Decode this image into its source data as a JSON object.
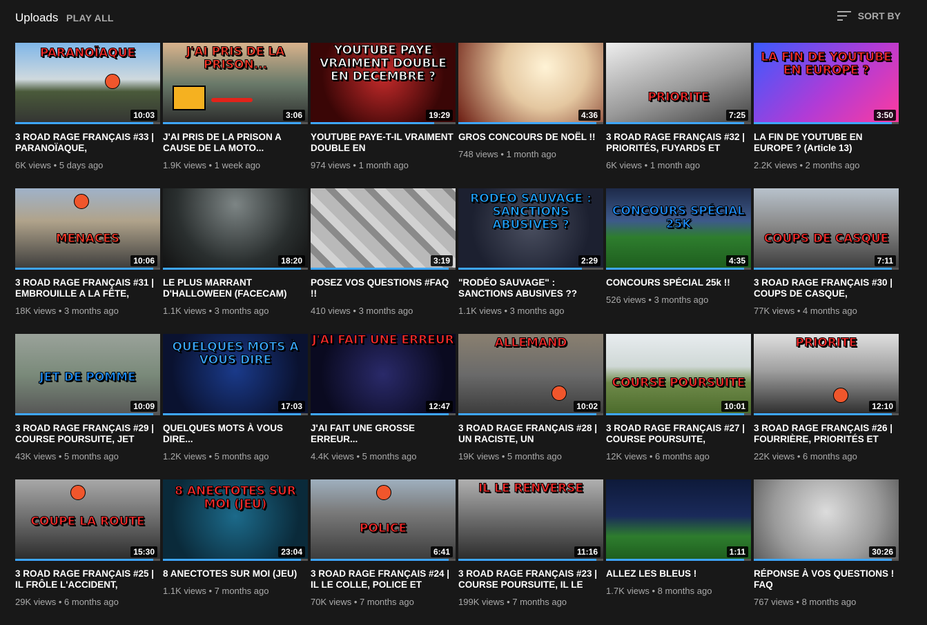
{
  "header": {
    "title": "Uploads",
    "play_all": "PLAY ALL",
    "sort_by": "SORT BY"
  },
  "colors": {
    "background": "#181818",
    "progress": "#3ea6ff",
    "meta_text": "#aaaaaa"
  },
  "videos": [
    {
      "title": "3 ROAD RAGE FRANÇAIS #33 | PARANOÏAQUE,",
      "views": "6K views",
      "age": "5 days ago",
      "duration": "10:03",
      "thumb_text": "PARANOÏAQUE",
      "progress": 0.95
    },
    {
      "title": "J'AI PRIS DE LA PRISON A CAUSE DE LA MOTO...",
      "views": "1.9K views",
      "age": "1 week ago",
      "duration": "3:06",
      "thumb_text": "J'AI PRIS DE LA PRISON...",
      "progress": 0.95
    },
    {
      "title": "YOUTUBE PAYE-T-IL VRAIMENT DOUBLE EN",
      "views": "974 views",
      "age": "1 month ago",
      "duration": "19:29",
      "thumb_text": "YOUTUBE PAYE VRAIMENT DOUBLE EN DECEMBRE ?",
      "progress": 0.85
    },
    {
      "title": "GROS CONCOURS DE NOËL !!",
      "views": "748 views",
      "age": "1 month ago",
      "duration": "4:36",
      "thumb_text": "",
      "progress": 0.95
    },
    {
      "title": "3 ROAD RAGE FRANÇAIS #32 | PRIORITÉS, FUYARDS ET",
      "views": "6K views",
      "age": "1 month ago",
      "duration": "7:25",
      "thumb_text": "PRIORITE",
      "progress": 0.95
    },
    {
      "title": "LA FIN DE YOUTUBE EN EUROPE ? (Article 13)",
      "views": "2.2K views",
      "age": "2 months ago",
      "duration": "3:50",
      "thumb_text": "LA FIN DE YOUTUBE EN EUROPE ?",
      "progress": 0.95
    },
    {
      "title": "3 ROAD RAGE FRANÇAIS #31 | EMBROUILLE A LA FÊTE,",
      "views": "18K views",
      "age": "3 months ago",
      "duration": "10:06",
      "thumb_text": "MENACES",
      "progress": 0.95
    },
    {
      "title": "LE PLUS MARRANT D'HALLOWEEN (FACECAM)",
      "views": "1.1K views",
      "age": "3 months ago",
      "duration": "18:20",
      "thumb_text": "",
      "progress": 0.95
    },
    {
      "title": "POSEZ VOS QUESTIONS #FAQ !!",
      "views": "410 views",
      "age": "3 months ago",
      "duration": "3:19",
      "thumb_text": "",
      "progress": 0.95
    },
    {
      "title": "\"RODÉO SAUVAGE\" : SANCTIONS ABUSIVES ??",
      "views": "1.1K views",
      "age": "3 months ago",
      "duration": "2:29",
      "thumb_text": "RODEO SAUVAGE : SANCTIONS ABUSIVES ?",
      "progress": 0.85
    },
    {
      "title": "CONCOURS SPÉCIAL 25k !!",
      "views": "526 views",
      "age": "3 months ago",
      "duration": "4:35",
      "thumb_text": "CONCOURS SPÉCIAL 25K",
      "progress": 0.95
    },
    {
      "title": "3 ROAD RAGE FRANÇAIS #30 | COUPS DE CASQUE,",
      "views": "77K views",
      "age": "4 months ago",
      "duration": "7:11",
      "thumb_text": "COUPS DE CASQUE",
      "progress": 0.95
    },
    {
      "title": "3 ROAD RAGE FRANÇAIS #29 | COURSE POURSUITE, JET",
      "views": "43K views",
      "age": "5 months ago",
      "duration": "10:09",
      "thumb_text": "JET DE POMME",
      "progress": 0.95
    },
    {
      "title": "QUELQUES MOTS À VOUS DIRE...",
      "views": "1.2K views",
      "age": "5 months ago",
      "duration": "17:03",
      "thumb_text": "QUELQUES MOTS À VOUS DIRE",
      "progress": 0.95
    },
    {
      "title": "J'AI FAIT UNE GROSSE ERREUR...",
      "views": "4.4K views",
      "age": "5 months ago",
      "duration": "12:47",
      "thumb_text": "J'AI FAIT UNE ERREUR",
      "progress": 0.95
    },
    {
      "title": "3 ROAD RAGE FRANÇAIS #28 | UN RACISTE, UN",
      "views": "19K views",
      "age": "5 months ago",
      "duration": "10:02",
      "thumb_text": "ALLEMAND",
      "progress": 0.95
    },
    {
      "title": "3 ROAD RAGE FRANÇAIS #27 | COURSE POURSUITE,",
      "views": "12K views",
      "age": "6 months ago",
      "duration": "10:01",
      "thumb_text": "COURSE POURSUITE",
      "progress": 0.95
    },
    {
      "title": "3 ROAD RAGE FRANÇAIS #26 | FOURRIÈRE, PRIORITÉS ET",
      "views": "22K views",
      "age": "6 months ago",
      "duration": "12:10",
      "thumb_text": "PRIORITE",
      "progress": 0.95
    },
    {
      "title": "3 ROAD RAGE FRANÇAIS #25 | IL FRÔLE L'ACCIDENT,",
      "views": "29K views",
      "age": "6 months ago",
      "duration": "15:30",
      "thumb_text": "COUPE LA ROUTE",
      "progress": 0.95
    },
    {
      "title": "8 ANECTOTES SUR MOI (JEU)",
      "views": "1.1K views",
      "age": "7 months ago",
      "duration": "23:04",
      "thumb_text": "8 ANECTOTES SUR MOI (JEU)",
      "progress": 0.95
    },
    {
      "title": "3 ROAD RAGE FRANÇAIS #24 | IL LE COLLE, POLICE ET",
      "views": "70K views",
      "age": "7 months ago",
      "duration": "6:41",
      "thumb_text": "POLICE",
      "progress": 0.95
    },
    {
      "title": "3 ROAD RAGE FRANÇAIS #23 | COURSE POURSUITE, IL LE",
      "views": "199K views",
      "age": "7 months ago",
      "duration": "11:16",
      "thumb_text": "IL LE RENVERSE",
      "progress": 0.95
    },
    {
      "title": "ALLEZ LES BLEUS !",
      "views": "1.7K views",
      "age": "8 months ago",
      "duration": "1:11",
      "thumb_text": "",
      "progress": 0.95
    },
    {
      "title": "RÉPONSE À VOS QUESTIONS ! FAQ",
      "views": "767 views",
      "age": "8 months ago",
      "duration": "30:26",
      "thumb_text": "",
      "progress": 0.95
    }
  ]
}
